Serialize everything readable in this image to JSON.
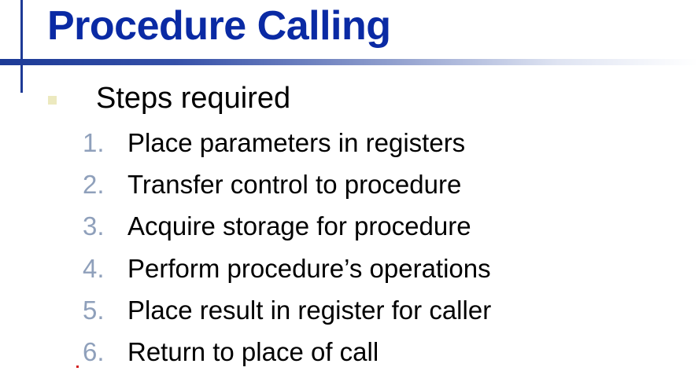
{
  "slide": {
    "title": "Procedure Calling",
    "bullet": "Steps required",
    "steps": [
      {
        "num": "1.",
        "text": "Place parameters in registers"
      },
      {
        "num": "2.",
        "text": "Transfer control to procedure"
      },
      {
        "num": "3.",
        "text": "Acquire storage for procedure"
      },
      {
        "num": "4.",
        "text": "Perform procedure’s operations"
      },
      {
        "num": "5.",
        "text": "Place result in register for caller"
      },
      {
        "num": "6.",
        "text": "Return to place of call"
      }
    ]
  },
  "colors": {
    "title": "#0a2aa4",
    "accent_line": "#1e3a96",
    "bullet": "#ece9bf",
    "step_number": "#8fa0bb",
    "text": "#000000"
  }
}
